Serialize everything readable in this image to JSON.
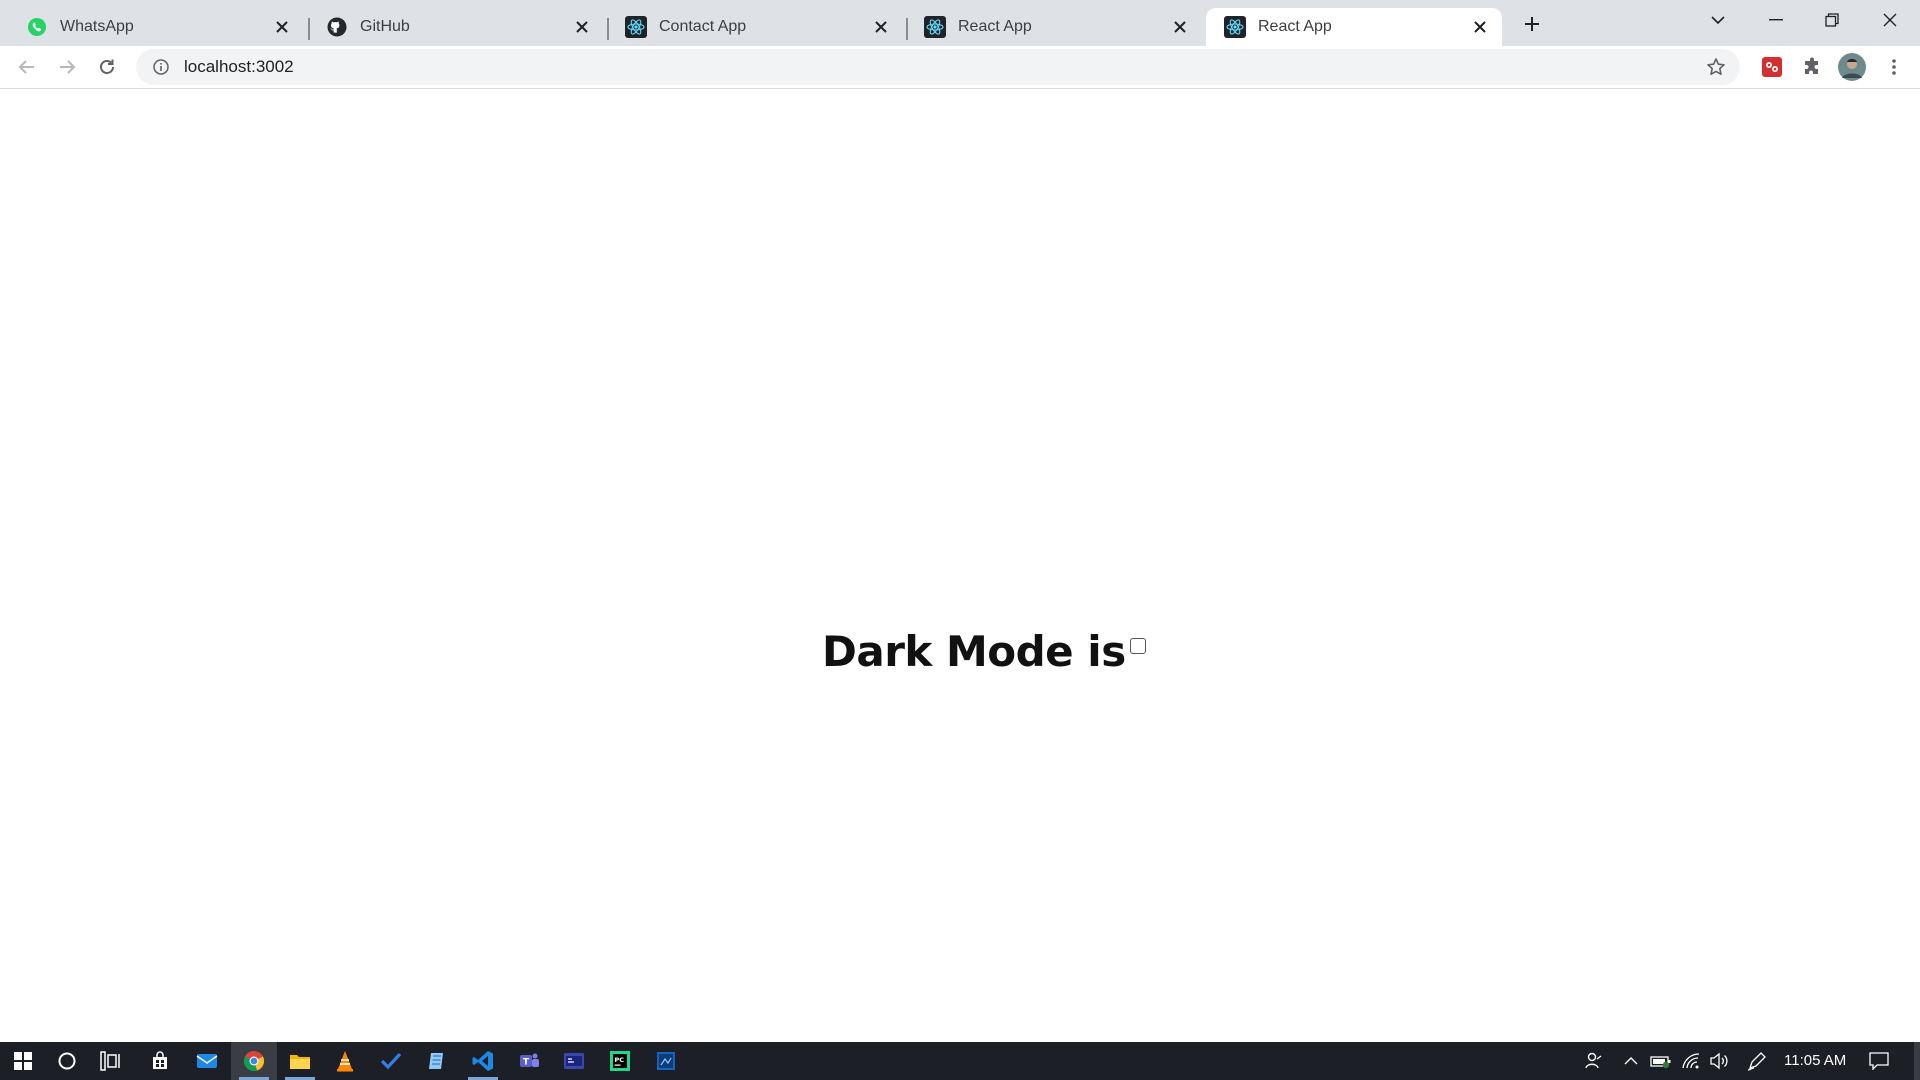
{
  "browser": {
    "tabs": [
      {
        "title": "WhatsApp",
        "icon": "whatsapp-icon",
        "active": false
      },
      {
        "title": "GitHub",
        "icon": "github-icon",
        "active": false
      },
      {
        "title": "Contact App",
        "icon": "react-icon",
        "active": false
      },
      {
        "title": "React App",
        "icon": "react-icon",
        "active": false
      },
      {
        "title": "React App",
        "icon": "react-icon",
        "active": true
      }
    ],
    "address": "localhost:3002"
  },
  "page": {
    "heading": "Dark Mode is",
    "dark_mode_checked": false
  },
  "taskbar": {
    "time": "11:05 AM"
  },
  "colors": {
    "tabstrip_bg": "#dee1e6",
    "omnibox_bg": "#f1f3f4",
    "taskbar_bg": "#1c1f26",
    "whatsapp_green": "#25d366",
    "react_blue": "#61dafb"
  }
}
